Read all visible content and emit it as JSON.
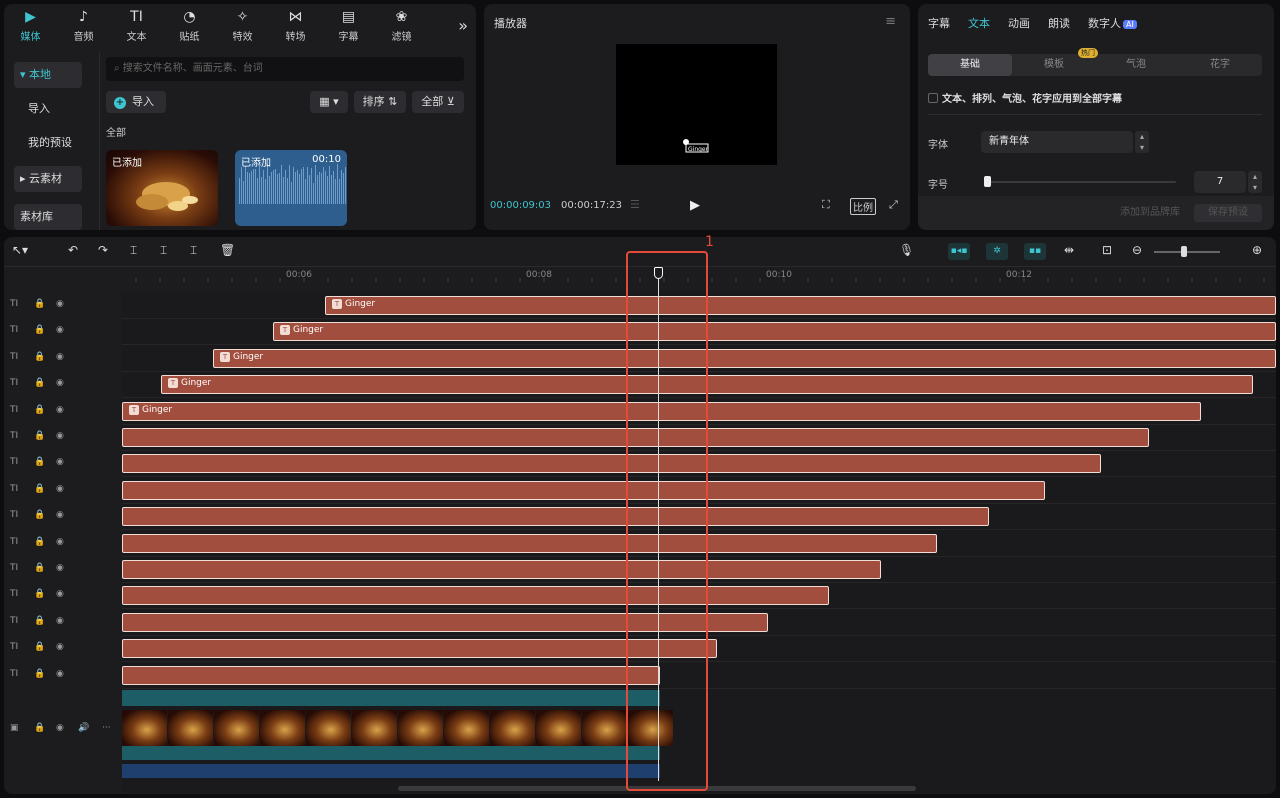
{
  "media": {
    "tabs": [
      {
        "label": "媒体",
        "icon": "media-icon",
        "glyph": "▶"
      },
      {
        "label": "音频",
        "icon": "audio-icon",
        "glyph": "♪"
      },
      {
        "label": "文本",
        "icon": "text-icon",
        "glyph": "TI"
      },
      {
        "label": "贴纸",
        "icon": "sticker-icon",
        "glyph": "◔"
      },
      {
        "label": "特效",
        "icon": "effects-icon",
        "glyph": "✧"
      },
      {
        "label": "转场",
        "icon": "transition-icon",
        "glyph": "⋈"
      },
      {
        "label": "字幕",
        "icon": "caption-icon",
        "glyph": "▤"
      },
      {
        "label": "滤镜",
        "icon": "filter-icon",
        "glyph": "❀"
      }
    ],
    "more_glyph": "»",
    "side_items": [
      "本地",
      "导入",
      "我的预设",
      "云素材",
      "素材库"
    ],
    "search_placeholder": "搜索文件名称、画面元素、台词",
    "import_label": "导入",
    "sort_label": "排序",
    "filter_label": "全部",
    "section_label": "全部",
    "thumb1_tag": "已添加",
    "thumb2_tag": "已添加",
    "thumb2_duration": "00:10"
  },
  "player": {
    "title": "播放器",
    "current_time": "00:00:09:03",
    "total_time": "00:00:17:23",
    "ratio_label": "比例"
  },
  "props": {
    "tabs": [
      "字幕",
      "文本",
      "动画",
      "朗读",
      "数字人"
    ],
    "ai_badge": "AI",
    "subtabs": [
      "基础",
      "模板",
      "气泡",
      "花字"
    ],
    "hot_badge": "热门",
    "apply_all_label": "文本、排列、气泡、花字应用到全部字幕",
    "font_label": "字体",
    "font_value": "新青年体",
    "size_label": "字号",
    "size_value": "7",
    "size_level": 0,
    "add_brand_label": "添加到品牌库",
    "save_preset_label": "保存预设"
  },
  "timeline": {
    "ruler_labels": [
      "00:06",
      "00:08",
      "00:10",
      "00:12"
    ],
    "clip_label": "Ginger",
    "video_text": "Ginger",
    "highlight_number": "1",
    "zoom_level": 0.52
  },
  "colors": {
    "accent": "#3ec5cf",
    "clip": "#a24e3e",
    "highlight": "#e44a3a"
  }
}
